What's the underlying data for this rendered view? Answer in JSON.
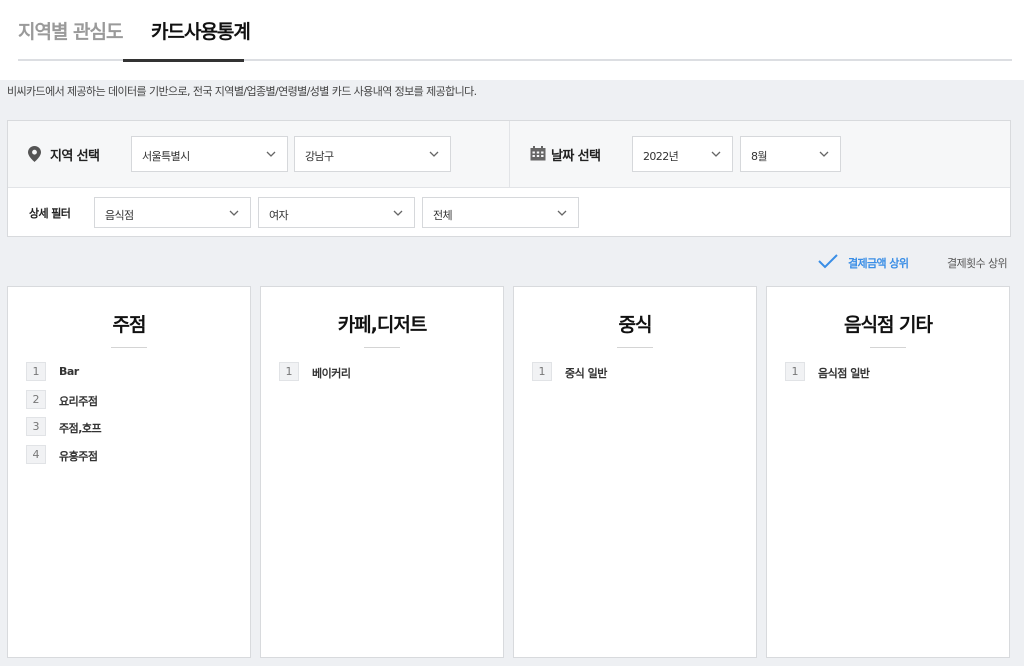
{
  "tabs": [
    {
      "label": "지역별 관심도"
    },
    {
      "label": "카드사용통계"
    }
  ],
  "description": "비씨카드에서 제공하는 데이터를 기반으로, 전국 지역별/업종별/연령별/성별 카드 사용내역 정보를 제공합니다.",
  "region": {
    "label": "지역 선택",
    "city": "서울특별시",
    "district": "강남구"
  },
  "date": {
    "label": "날짜 선택",
    "year": "2022년",
    "month": "8월"
  },
  "detail": {
    "label": "상세 필터",
    "category": "음식점",
    "gender": "여자",
    "age": "전체"
  },
  "sort": {
    "active": "결제금액 상위",
    "inactive": "결제횟수 상위"
  },
  "cards": [
    {
      "title": "주점",
      "items": [
        {
          "rank": "1",
          "name": "Bar"
        },
        {
          "rank": "2",
          "name": "요리주점"
        },
        {
          "rank": "3",
          "name": "주점,호프"
        },
        {
          "rank": "4",
          "name": "유흥주점"
        }
      ]
    },
    {
      "title": "카페,디저트",
      "items": [
        {
          "rank": "1",
          "name": "베이커리"
        }
      ]
    },
    {
      "title": "중식",
      "items": [
        {
          "rank": "1",
          "name": "중식 일반"
        }
      ]
    },
    {
      "title": "음식점 기타",
      "items": [
        {
          "rank": "1",
          "name": "음식점 일반"
        }
      ]
    }
  ],
  "colors": {
    "accent": "#3a8ee6",
    "background": "#eef0f3"
  }
}
